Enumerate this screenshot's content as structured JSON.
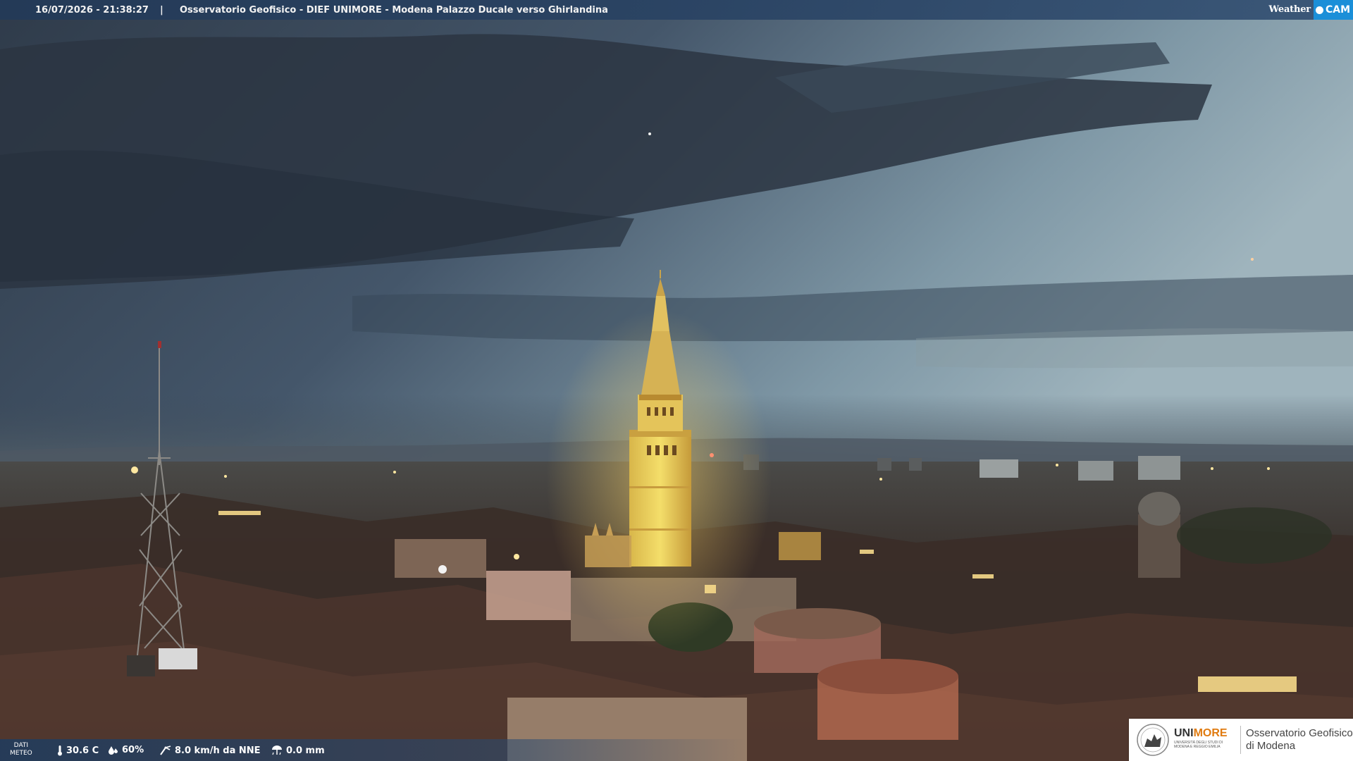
{
  "header": {
    "timestamp": "16/07/2026 - 21:38:27",
    "separator": "|",
    "title": "Osservatorio Geofisico - DIEF UNIMORE - Modena Palazzo Ducale verso Ghirlandina"
  },
  "brand": {
    "weather": "Weather",
    "cam": "CAM"
  },
  "weather_data": {
    "label_line1": "DATI",
    "label_line2": "METEO",
    "temperature": "30.6 C",
    "humidity": "60%",
    "wind": "8.0 km/h da NNE",
    "rain": "0.0 mm",
    "icons": [
      "thermometer-icon",
      "humidity-drop-icon",
      "wind-icon",
      "rain-icon"
    ]
  },
  "logo": {
    "unimore_part1": "UNI",
    "unimore_part2": "MORE",
    "university_line": "UNIVERSITÀ DEGLI STUDI DI MODENA E REGGIO EMILIA",
    "observatory_line1": "Osservatorio Geofisico",
    "observatory_line2": "di Modena"
  },
  "colors": {
    "accent_blue": "#1b8fd8",
    "unimore_orange": "#e07b10",
    "bar_blue": "#2d4a6e"
  }
}
